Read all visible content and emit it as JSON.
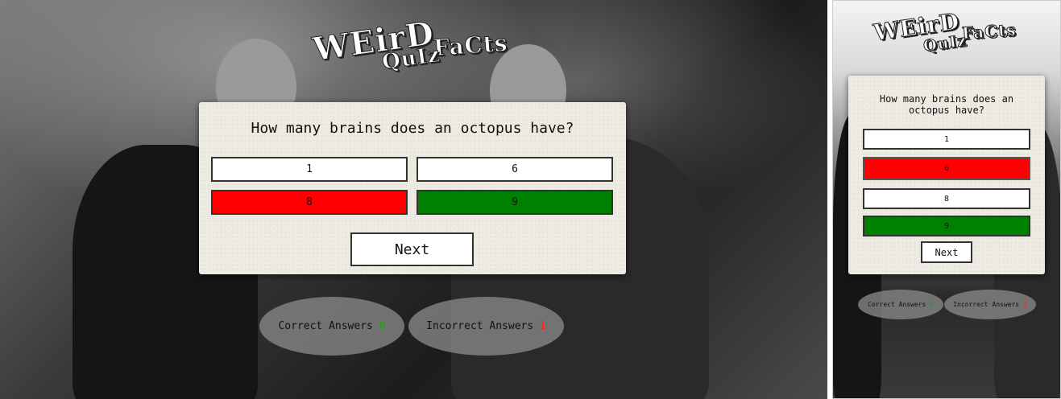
{
  "logo": {
    "line1": "WEirD",
    "line2": "FaCts",
    "line3": "QuIz"
  },
  "quiz": {
    "question": "How many brains does an octopus have?",
    "answers_desktop": [
      "1",
      "6",
      "8",
      "9"
    ],
    "answers_mobile": [
      "1",
      "6",
      "8",
      "9"
    ],
    "next_label": "Next"
  },
  "score": {
    "correct_label": "Correct Answers",
    "correct_value": "0",
    "incorrect_label": "Incorrect Answers",
    "incorrect_value": "1"
  },
  "colors": {
    "wrong": "#ff0000",
    "right": "#008000",
    "card": "#eeebe3"
  }
}
